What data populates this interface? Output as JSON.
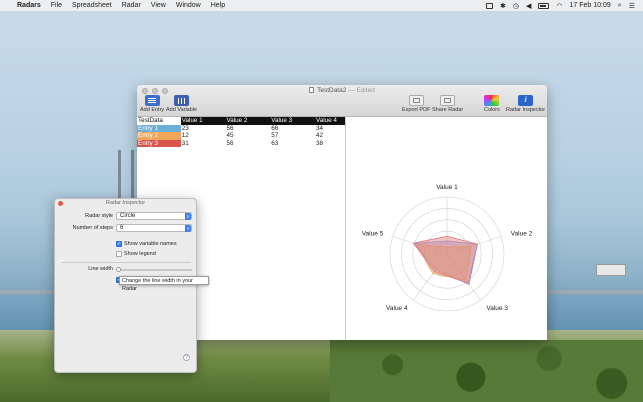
{
  "menubar": {
    "app": "Radars",
    "items": [
      "File",
      "Spreadsheet",
      "Radar",
      "View",
      "Window",
      "Help"
    ],
    "datetime": "17 Feb  10:09"
  },
  "window": {
    "title": "TestData2",
    "edited": "— Edited",
    "toolbar": {
      "add_entry": "Add Entry",
      "add_variable": "Add Variable",
      "export_pdf": "Export PDF",
      "share_radar": "Share Radar",
      "colors": "Colors",
      "radar_inspector": "Radar Inspector"
    }
  },
  "spreadsheet": {
    "headers": [
      "TestData",
      "Value 1",
      "Value 2",
      "Value 3",
      "Value 4"
    ],
    "rows": [
      {
        "name": "Entry 1",
        "color": "#6baed6",
        "values": [
          "23",
          "56",
          "66",
          "34"
        ]
      },
      {
        "name": "Entry 2",
        "color": "#f2a65a",
        "values": [
          "12",
          "45",
          "57",
          "42"
        ]
      },
      {
        "name": "Entry 3",
        "color": "#d9534f",
        "values": [
          "31",
          "56",
          "63",
          "38"
        ]
      }
    ]
  },
  "radar": {
    "axes": [
      "Value 1",
      "Value 2",
      "Value 3",
      "Value 4",
      "Value 5"
    ]
  },
  "chart_data": {
    "type": "radar",
    "axes": [
      "Value 1",
      "Value 2",
      "Value 3",
      "Value 4",
      "Value 5"
    ],
    "rings": 5,
    "series": [
      {
        "name": "Entry 1",
        "color": "#8f9ad6",
        "values": [
          23,
          56,
          66,
          34,
          60
        ]
      },
      {
        "name": "Entry 2",
        "color": "#f2a65a",
        "values": [
          12,
          45,
          57,
          42,
          55
        ]
      },
      {
        "name": "Entry 3",
        "color": "#e07a7a",
        "values": [
          31,
          56,
          63,
          38,
          62
        ]
      }
    ]
  },
  "inspector": {
    "title": "Radar Inspector",
    "radar_style_label": "Radar style",
    "radar_style_value": "Circle",
    "steps_label": "Number of steps",
    "steps_value": "6",
    "show_variable_names": "Show variable names",
    "show_legend": "Show legend",
    "line_width_label": "Line width",
    "tooltip": "Change the line width in your Radar",
    "help": "?"
  }
}
